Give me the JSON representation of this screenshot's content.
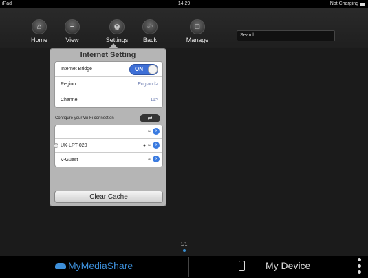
{
  "status_bar": {
    "device": "iPad",
    "time": "14:29",
    "battery_text": "Not Charging"
  },
  "toolbar": {
    "items": [
      {
        "label": "Home",
        "icon": "home-icon"
      },
      {
        "label": "View",
        "icon": "menu-icon"
      },
      {
        "label": "Settings",
        "icon": "gear-icon"
      },
      {
        "label": "Back",
        "icon": "back-icon"
      },
      {
        "label": "Manage",
        "icon": "folder-icon"
      }
    ],
    "search_placeholder": "Search"
  },
  "internet_setting": {
    "title": "Internet Setting",
    "bridge": {
      "label": "Internet Bridge",
      "state": "ON"
    },
    "region": {
      "label": "Region",
      "value": "England>"
    },
    "channel": {
      "label": "Channel",
      "value": "11>"
    },
    "wifi_header": "Configure your Wi-Fi connection",
    "networks": [
      {
        "name": "",
        "locked": false,
        "selected": false
      },
      {
        "name": "UK-LPT-020",
        "locked": true,
        "selected": false
      },
      {
        "name": "V-Guest",
        "locked": false,
        "selected": false
      }
    ],
    "clear_cache_label": "Clear Cache"
  },
  "pager": {
    "text": "1/1"
  },
  "bottom_bar": {
    "left_label": "MyMediaShare",
    "right_label": "My Device",
    "accent": "#3d8fd9"
  }
}
